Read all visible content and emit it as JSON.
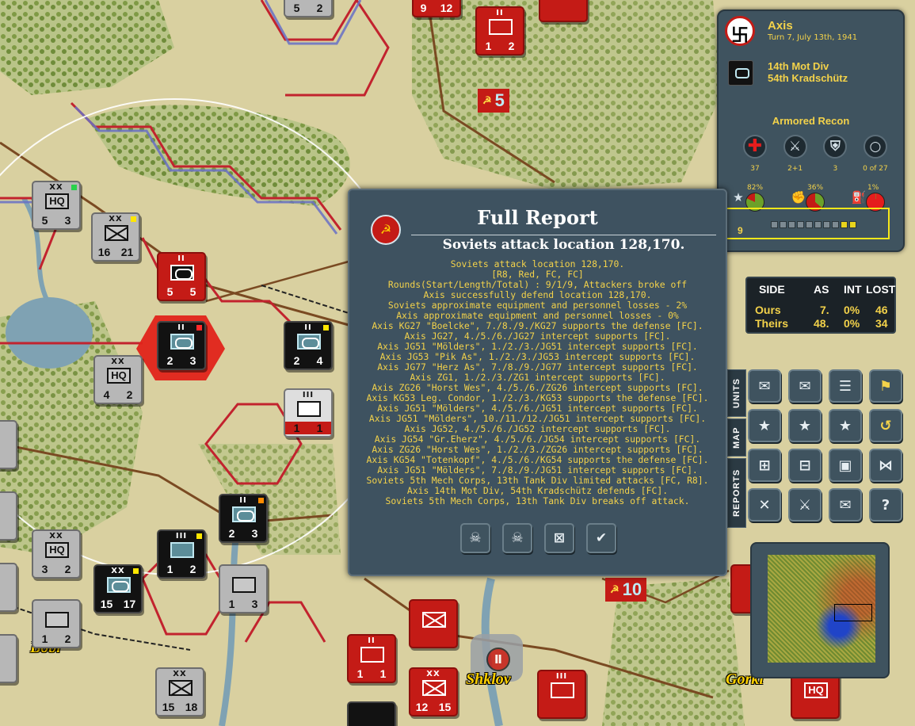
{
  "side_panel": {
    "side": "Axis",
    "turn": "Turn 7, July 13th, 1941",
    "unit_division": "14th Mot Div",
    "unit_name": "54th Kradschütz",
    "unit_type": "Armored Recon",
    "stats": [
      {
        "icon": "medical-cross-icon",
        "value": "37"
      },
      {
        "icon": "crossed-swords-icon",
        "value": "2+1"
      },
      {
        "icon": "shield-icon",
        "value": "3"
      },
      {
        "icon": "ring-icon",
        "value": "0 of 27"
      }
    ],
    "gauges": [
      {
        "icon": "star-icon",
        "percent": "82%"
      },
      {
        "icon": "fist-icon",
        "percent": "36%"
      },
      {
        "icon": "fuel-can-icon",
        "percent": "1%"
      }
    ],
    "experience_level": "9",
    "experience_bar": {
      "total": 10,
      "filled": 2
    }
  },
  "losses_table": {
    "headers": [
      "SIDE",
      "AS",
      "INT",
      "LOST"
    ],
    "rows": [
      [
        "Ours",
        "7.",
        "0%",
        "46"
      ],
      [
        "Theirs",
        "48.",
        "0%",
        "34"
      ]
    ]
  },
  "side_tabs": [
    "UNITS",
    "MAP",
    "REPORTS"
  ],
  "report": {
    "title": "Full Report",
    "subtitle": "Soviets attack location 128,170.",
    "lines": [
      "Soviets attack location 128,170.",
      "[R8, Red, FC, FC]",
      "Rounds(Start/Length/Total) : 9/1/9, Attackers broke off",
      "Axis successfully defend location 128,170.",
      "Soviets approximate equipment and personnel losses - 2%",
      "Axis approximate equipment and personnel losses - 0%",
      "Axis KG27 \"Boelcke\", 7./8./9./KG27 supports the defense [FC].",
      "Axis JG27, 4./5./6./JG27 intercept supports [FC].",
      "Axis JG51 \"Mölders\", 1./2./3./JG51 intercept supports [FC].",
      "Axis JG53 \"Pik As\", 1./2./3./JG53 intercept supports [FC].",
      "Axis JG77 \"Herz As\", 7./8./9./JG77 intercept supports [FC].",
      "Axis ZG1, 1./2./3./ZG1 intercept supports [FC].",
      "Axis ZG26 \"Horst Wes\", 4./5./6./ZG26 intercept supports [FC].",
      "Axis KG53 Leg. Condor, 1./2./3./KG53 supports the defense [FC].",
      "Axis JG51 \"Mölders\", 4./5./6./JG51 intercept supports [FC].",
      "Axis JG51 \"Mölders\", 10./11./12./JG51 intercept supports [FC].",
      "Axis JG52, 4./5./6./JG52 intercept supports [FC].",
      "Axis JG54 \"Gr.Eherz\", 4./5./6./JG54 intercept supports [FC].",
      "Axis ZG26 \"Horst Wes\", 1./2./3./ZG26 intercept supports [FC].",
      "Axis KG54 \"Totenkopf\", 4./5./6./KG54 supports the defense [FC].",
      "Axis JG51 \"Mölders\", 7./8./9./JG51 intercept supports [FC].",
      "Soviets 5th Mech Corps, 13th Tank Div limited attacks [FC, R8].",
      "Axis 14th Mot Div, 54th Kradschütz defends [FC].",
      "Soviets 5th Mech Corps, 13th Tank Div breaks off attack."
    ],
    "buttons": [
      "shield-skull-icon",
      "sword-skull-icon",
      "casualties-icon",
      "ok-check-icon"
    ]
  },
  "map": {
    "cities": [
      "Shklov",
      "Gorki",
      "Bobr"
    ],
    "victory_points": [
      "5",
      "10"
    ],
    "counters": [
      {
        "side": "red",
        "size": "II",
        "a": "9",
        "b": "12"
      },
      {
        "side": "red",
        "size": "II",
        "a": "1",
        "b": "2"
      },
      {
        "side": "grey",
        "size": "",
        "a": "5",
        "b": "2"
      },
      {
        "side": "grey",
        "size": "XX",
        "a": "5",
        "b": "3",
        "sym": "HQ"
      },
      {
        "side": "grey",
        "size": "XX",
        "a": "16",
        "b": "21"
      },
      {
        "side": "red",
        "size": "II",
        "a": "5",
        "b": "5"
      },
      {
        "side": "black",
        "size": "II",
        "a": "2",
        "b": "3"
      },
      {
        "side": "black",
        "size": "II",
        "a": "2",
        "b": "4"
      },
      {
        "side": "grey",
        "size": "XX",
        "a": "4",
        "b": "2",
        "sym": "HQ"
      },
      {
        "side": "red",
        "size": "III",
        "a": "1",
        "b": "1"
      },
      {
        "side": "black",
        "size": "II",
        "a": "2",
        "b": "3"
      },
      {
        "side": "black",
        "size": "III",
        "a": "1",
        "b": "2"
      },
      {
        "side": "grey",
        "size": "XX",
        "a": "3",
        "b": "2",
        "sym": "HQ"
      },
      {
        "side": "black",
        "size": "XX",
        "a": "15",
        "b": "17"
      },
      {
        "side": "grey",
        "size": "",
        "a": "1",
        "b": "3"
      },
      {
        "side": "grey",
        "size": "",
        "a": "1",
        "b": "2"
      },
      {
        "side": "red",
        "size": "II",
        "a": "1",
        "b": "1"
      },
      {
        "side": "red",
        "size": "XX",
        "a": "12",
        "b": "15"
      },
      {
        "side": "grey",
        "size": "XX",
        "a": "15",
        "b": "18"
      },
      {
        "side": "red",
        "size": "III",
        "a": "",
        "b": ""
      },
      {
        "side": "red",
        "size": "",
        "a": "",
        "b": "",
        "sym": "HQ"
      }
    ]
  }
}
